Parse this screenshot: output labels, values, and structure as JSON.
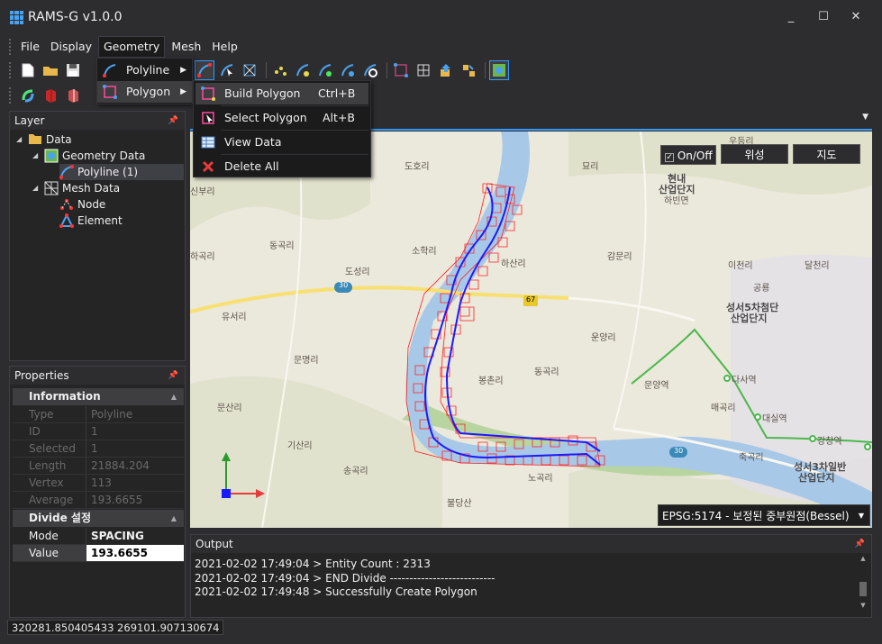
{
  "window": {
    "title": "RAMS-G v1.0.0",
    "minimize": "_",
    "maximize": "☐",
    "close": "✕"
  },
  "menu": {
    "items": [
      "File",
      "Display",
      "Geometry",
      "Mesh",
      "Help"
    ],
    "active": "Geometry"
  },
  "geometry_menu": {
    "items": [
      {
        "label": "Polyline",
        "icon": "polyline-icon",
        "has_submenu": true
      },
      {
        "label": "Polygon",
        "icon": "polygon-icon",
        "has_submenu": true
      }
    ]
  },
  "polygon_submenu": {
    "items": [
      {
        "label": "Build Polygon",
        "shortcut": "Ctrl+B",
        "icon": "build-polygon-icon"
      },
      {
        "label": "Select Polygon",
        "shortcut": "Alt+B",
        "icon": "select-polygon-icon"
      },
      {
        "label": "View Data",
        "shortcut": "",
        "icon": "table-icon"
      },
      {
        "label": "Delete All",
        "shortcut": "",
        "icon": "delete-icon"
      }
    ]
  },
  "layer_panel": {
    "title": "Layer",
    "tree": [
      {
        "label": "Data",
        "level": 0,
        "icon": "folder-icon",
        "expander": "◢"
      },
      {
        "label": "Geometry Data",
        "level": 1,
        "icon": "geometry-data-icon",
        "expander": "◢"
      },
      {
        "label": "Polyline (1)",
        "level": 2,
        "icon": "polyline-icon",
        "expander": ""
      },
      {
        "label": "Mesh Data",
        "level": 1,
        "icon": "mesh-data-icon",
        "expander": "◢"
      },
      {
        "label": "Node",
        "level": 2,
        "icon": "node-icon",
        "expander": ""
      },
      {
        "label": "Element",
        "level": 2,
        "icon": "element-icon",
        "expander": ""
      }
    ]
  },
  "properties_panel": {
    "title": "Properties",
    "information": {
      "title": "Information",
      "rows": [
        {
          "key": "Type",
          "value": "Polyline"
        },
        {
          "key": "ID",
          "value": "1"
        },
        {
          "key": "Selected",
          "value": "1"
        },
        {
          "key": "Length",
          "value": "21884.204"
        },
        {
          "key": "Vertex",
          "value": "113"
        },
        {
          "key": "Average ...",
          "value": "193.6655"
        }
      ]
    },
    "divide": {
      "title": "Divide 설정",
      "rows": [
        {
          "key": "Mode",
          "value": "SPACING"
        },
        {
          "key": "Value",
          "value": "193.6655"
        }
      ]
    }
  },
  "map": {
    "onoff_label": "On/Off",
    "satellite_label": "위성",
    "map_label": "지도",
    "projection": "EPSG:5174 - 보정된 중부원점(Bessel)",
    "labels": [
      {
        "text": "우등리"
      },
      {
        "text": "도호리"
      },
      {
        "text": "묘리"
      },
      {
        "text": "현내"
      },
      {
        "text": "산업단지"
      },
      {
        "text": "하빈면"
      },
      {
        "text": "신부리"
      },
      {
        "text": "소학리"
      },
      {
        "text": "하산리"
      },
      {
        "text": "감문리"
      },
      {
        "text": "이천리"
      },
      {
        "text": "달천리"
      },
      {
        "text": "동곡리"
      },
      {
        "text": "하곡리"
      },
      {
        "text": "도성리"
      },
      {
        "text": "유서리"
      },
      {
        "text": "운양리"
      },
      {
        "text": "문명리"
      },
      {
        "text": "봉촌리"
      },
      {
        "text": "동곡리"
      },
      {
        "text": "문양역"
      },
      {
        "text": "다사역"
      },
      {
        "text": "매곡리"
      },
      {
        "text": "대실역"
      },
      {
        "text": "강창역"
      },
      {
        "text": "문산리"
      },
      {
        "text": "기산리"
      },
      {
        "text": "죽곡리"
      },
      {
        "text": "송곡리"
      },
      {
        "text": "노곡리"
      },
      {
        "text": "불당산"
      },
      {
        "text": "성서5차첨단"
      },
      {
        "text": "산업단지"
      },
      {
        "text": "성서3차일반"
      },
      {
        "text": "산업단지"
      },
      {
        "text": "공룡"
      },
      {
        "text": "30"
      },
      {
        "text": "67"
      },
      {
        "text": "30"
      }
    ]
  },
  "output": {
    "title": "Output",
    "lines": [
      "2021-02-02 17:49:04 > Entity Count : 2313",
      "2021-02-02 17:49:04 > END Divide ---------------------------",
      "2021-02-02 17:49:48 > Successfully Create Polygon"
    ]
  },
  "status_bar": {
    "coordinates": "320281.850405433 269101.907130674"
  },
  "colors": {
    "accent": "#3399ff",
    "polyline": "#1a1aff",
    "polygon": "#ff2020",
    "water": "#a8c8e8"
  }
}
